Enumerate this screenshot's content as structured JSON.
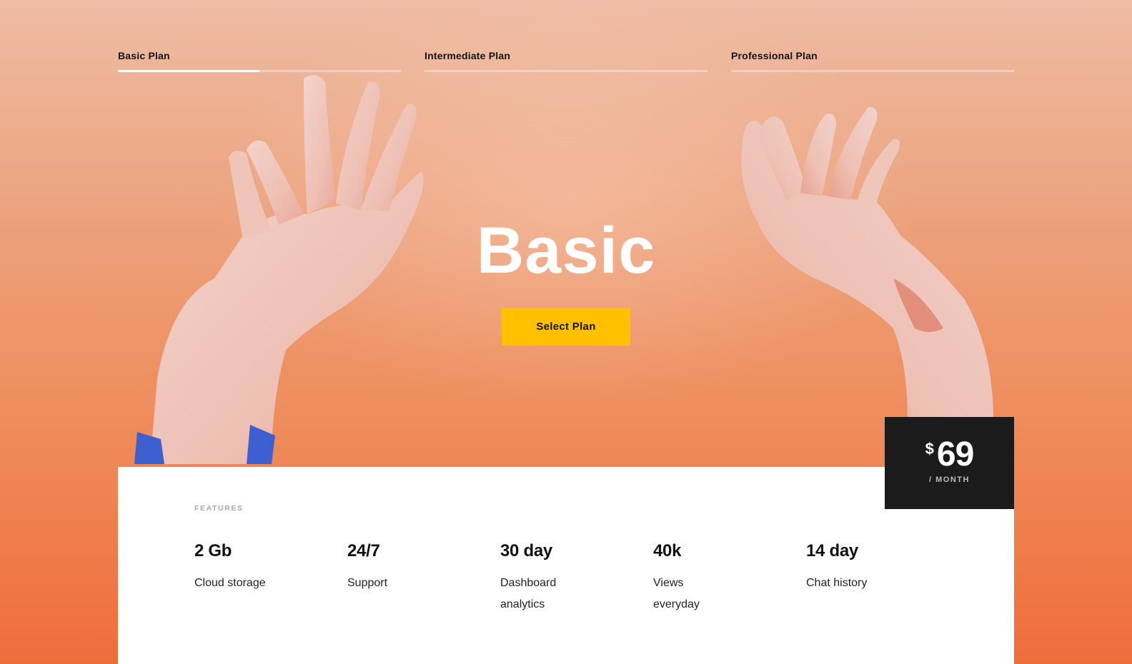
{
  "tabs": [
    {
      "label": "Basic Plan",
      "active": true,
      "progress": 0.5
    },
    {
      "label": "Intermediate Plan",
      "active": false,
      "progress": 0
    },
    {
      "label": "Professional Plan",
      "active": false,
      "progress": 0
    }
  ],
  "hero": {
    "title": "Basic",
    "button_label": "Select Plan"
  },
  "price": {
    "currency": "$",
    "amount": "69",
    "period": "/ MONTH"
  },
  "features": {
    "label": "FEATURES",
    "items": [
      {
        "value": "2 Gb",
        "description": "Cloud storage"
      },
      {
        "value": "24/7",
        "description": "Support"
      },
      {
        "value": "30 day",
        "description": "Dashboard analytics"
      },
      {
        "value": "40k",
        "description": "Views everyday"
      },
      {
        "value": "14 day",
        "description": "Chat history"
      }
    ]
  },
  "colors": {
    "accent_button": "#ffc000",
    "price_box": "#1b1b1b",
    "background_top": "#eebca4",
    "background_bottom": "#ef6d3b"
  },
  "icons": {
    "left_image": "raised-left-hand-image",
    "right_image": "raised-right-hand-image"
  }
}
